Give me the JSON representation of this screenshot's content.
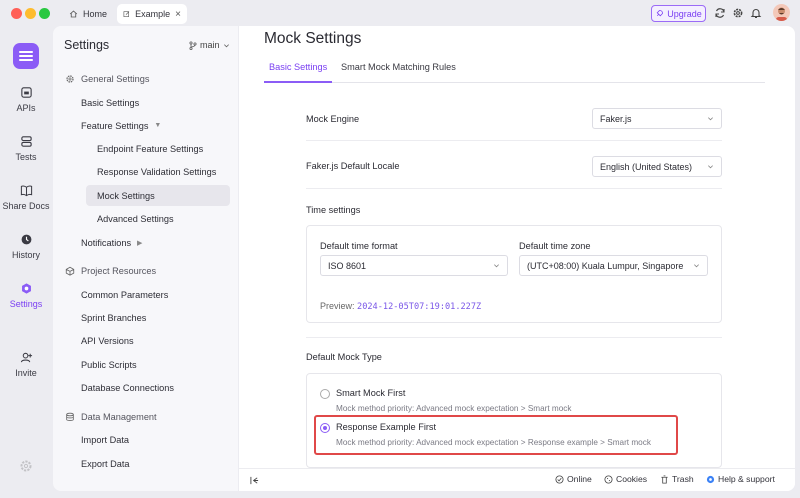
{
  "titlebar": {
    "tabs": [
      {
        "label": "Home",
        "icon": "home-icon"
      },
      {
        "label": "Example",
        "icon": "edit-icon",
        "close": "×"
      }
    ],
    "upgrade_label": "Upgrade"
  },
  "rail": {
    "items": [
      {
        "label": "APIs",
        "icon": "api-icon"
      },
      {
        "label": "Tests",
        "icon": "tests-icon"
      },
      {
        "label": "Share Docs",
        "icon": "book-icon"
      },
      {
        "label": "History",
        "icon": "clock-icon"
      },
      {
        "label": "Settings",
        "icon": "settings-icon"
      },
      {
        "label": "Invite",
        "icon": "add-user-icon"
      }
    ]
  },
  "sidebar": {
    "title": "Settings",
    "branch": "main",
    "sections": [
      {
        "label": "General Settings"
      },
      {
        "label": "Project Resources"
      },
      {
        "label": "Data Management"
      }
    ],
    "items": [
      {
        "label": "Basic Settings"
      },
      {
        "label": "Feature Settings"
      },
      {
        "label": "Endpoint Feature Settings"
      },
      {
        "label": "Response Validation Settings"
      },
      {
        "label": "Mock Settings"
      },
      {
        "label": "Advanced Settings"
      },
      {
        "label": "Notifications"
      },
      {
        "label": "Common Parameters"
      },
      {
        "label": "Sprint Branches"
      },
      {
        "label": "API Versions"
      },
      {
        "label": "Public Scripts"
      },
      {
        "label": "Database Connections"
      },
      {
        "label": "Import Data"
      },
      {
        "label": "Export Data"
      }
    ]
  },
  "main": {
    "title": "Mock Settings",
    "tabs": [
      {
        "label": "Basic Settings"
      },
      {
        "label": "Smart Mock Matching Rules"
      }
    ],
    "mock_engine": {
      "label": "Mock Engine",
      "value": "Faker.js"
    },
    "locale": {
      "label": "Faker.js Default Locale",
      "value": "English (United States)"
    },
    "time": {
      "label": "Time settings",
      "format_label": "Default time format",
      "format_value": "ISO 8601",
      "zone_label": "Default time zone",
      "zone_value": "(UTC+08:00) Kuala Lumpur, Singapore",
      "preview_label": "Preview:",
      "preview_value": "2024-12-05T07:19:01.227Z"
    },
    "mock_type": {
      "label": "Default Mock Type",
      "options": [
        {
          "title": "Smart Mock First",
          "desc": "Mock method priority: Advanced mock expectation > Smart mock",
          "selected": false
        },
        {
          "title": "Response Example First",
          "desc": "Mock method priority: Advanced mock expectation > Response example > Smart mock",
          "selected": true
        }
      ]
    }
  },
  "footer": {
    "online": "Online",
    "cookies": "Cookies",
    "trash": "Trash",
    "help": "Help & support"
  },
  "colors": {
    "accent": "#8b5cf6",
    "highlight_box": "#e04848"
  }
}
